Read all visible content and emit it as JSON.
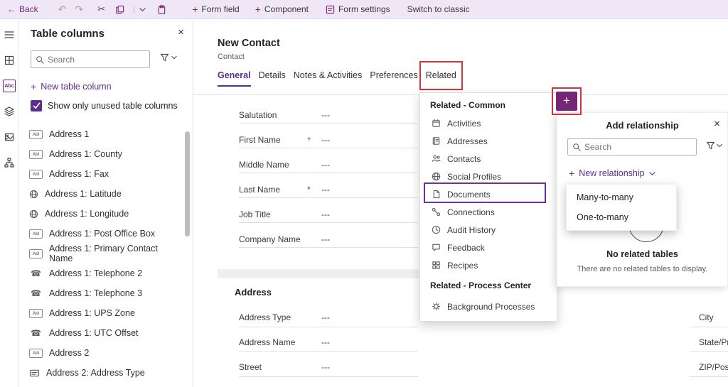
{
  "topbar": {
    "back_label": "Back",
    "form_field_label": "Form field",
    "component_label": "Component",
    "form_settings_label": "Form settings",
    "switch_to_classic_label": "Switch to classic"
  },
  "table_columns_panel": {
    "title": "Table columns",
    "search_placeholder": "Search",
    "new_table_column_label": "New table column",
    "show_unused_label": "Show only unused table columns",
    "columns": [
      {
        "icon": "text-field",
        "label": "Address 1"
      },
      {
        "icon": "text-field",
        "label": "Address 1: County"
      },
      {
        "icon": "text-field",
        "label": "Address 1: Fax"
      },
      {
        "icon": "globe",
        "label": "Address 1: Latitude"
      },
      {
        "icon": "globe",
        "label": "Address 1: Longitude"
      },
      {
        "icon": "text-field",
        "label": "Address 1: Post Office Box"
      },
      {
        "icon": "text-field",
        "label": "Address 1: Primary Contact Name"
      },
      {
        "icon": "phone",
        "label": "Address 1: Telephone 2"
      },
      {
        "icon": "phone",
        "label": "Address 1: Telephone 3"
      },
      {
        "icon": "text-field",
        "label": "Address 1: UPS Zone"
      },
      {
        "icon": "phone",
        "label": "Address 1: UTC Offset"
      },
      {
        "icon": "text-field",
        "label": "Address 2"
      },
      {
        "icon": "option-set",
        "label": "Address 2: Address Type"
      }
    ]
  },
  "canvas": {
    "form_title": "New Contact",
    "form_subtitle": "Contact",
    "tabs": [
      "General",
      "Details",
      "Notes & Activities",
      "Preferences",
      "Related"
    ],
    "fields": [
      {
        "label": "Salutation",
        "marker": "",
        "value": "---"
      },
      {
        "label": "First Name",
        "marker": "+",
        "value": "---"
      },
      {
        "label": "Middle Name",
        "marker": "",
        "value": "---"
      },
      {
        "label": "Last Name",
        "marker": "*",
        "value": "---"
      },
      {
        "label": "Job Title",
        "marker": "",
        "value": "---"
      },
      {
        "label": "Company Name",
        "marker": "",
        "value": "---"
      }
    ],
    "address": {
      "section_title": "Address",
      "fields": [
        {
          "label": "Address Type",
          "value": "---"
        },
        {
          "label": "Address Name",
          "value": "---"
        },
        {
          "label": "Street",
          "value": "---"
        }
      ],
      "right_labels": [
        "City",
        "State/Pro",
        "ZIP/Posta"
      ]
    }
  },
  "related_menu": {
    "common_header": "Related - Common",
    "common_items": [
      {
        "icon": "activities",
        "label": "Activities"
      },
      {
        "icon": "addresses",
        "label": "Addresses"
      },
      {
        "icon": "contacts",
        "label": "Contacts"
      },
      {
        "icon": "social-profiles",
        "label": "Social Profiles"
      },
      {
        "icon": "documents",
        "label": "Documents"
      },
      {
        "icon": "connections",
        "label": "Connections"
      },
      {
        "icon": "audit-history",
        "label": "Audit History"
      },
      {
        "icon": "feedback",
        "label": "Feedback"
      },
      {
        "icon": "recipes",
        "label": "Recipes"
      }
    ],
    "process_header": "Related - Process Center",
    "process_items": [
      {
        "icon": "background-processes",
        "label": "Background Processes"
      }
    ]
  },
  "add_relationship_panel": {
    "title": "Add relationship",
    "search_placeholder": "Search",
    "new_relationship_label": "New relationship",
    "dropdown_items": [
      "Many-to-many",
      "One-to-many"
    ],
    "empty_state_title": "No related tables",
    "empty_state_message": "There are no related tables to display."
  },
  "colors": {
    "brand_purple": "#742774",
    "accent_purple": "#5c2d91",
    "annotation_red": "#d13438",
    "required_red": "#a4262c",
    "recommended_blue": "#0f6cbd",
    "topbar_background": "#efe7f5"
  }
}
